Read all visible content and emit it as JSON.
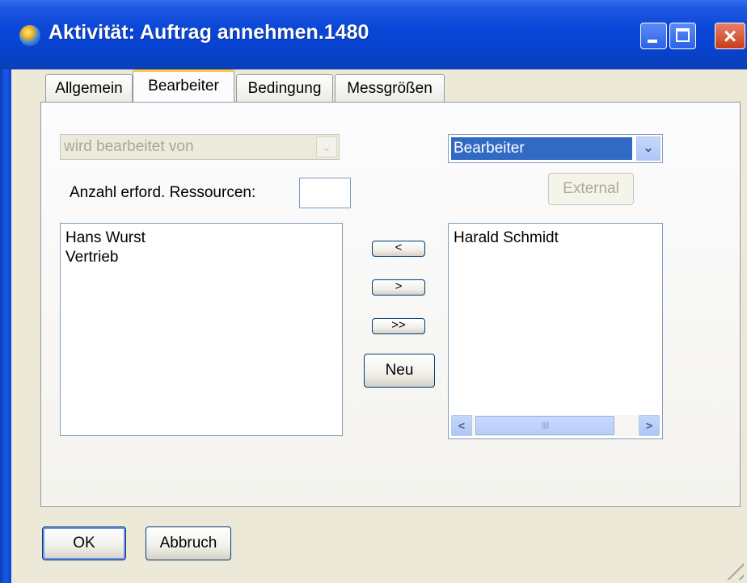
{
  "window": {
    "title": "Aktivität: Auftrag annehmen.1480",
    "icon": "app-globe-icon",
    "controls": {
      "minimize": "minimize-icon",
      "maximize": "maximize-icon",
      "close": "×"
    }
  },
  "tabs": [
    {
      "label": "Allgemein",
      "active": false
    },
    {
      "label": "Bearbeiter",
      "active": true
    },
    {
      "label": "Bedingung",
      "active": false
    },
    {
      "label": "Messgrößen",
      "active": false
    }
  ],
  "relation_combo": {
    "value": "wird bearbeitet von",
    "disabled": true,
    "arrow": "⌄"
  },
  "type_combo": {
    "value": "Bearbeiter",
    "arrow": "⌄"
  },
  "external_button": {
    "label": "External",
    "disabled": true
  },
  "resources": {
    "label": "Anzahl erford. Ressourcen:",
    "value": ""
  },
  "available_list": {
    "items": [
      "Hans Wurst",
      "Vertrieb"
    ]
  },
  "assigned_list": {
    "items": [
      "Harald Schmidt"
    ]
  },
  "move_buttons": {
    "left": "<",
    "right": ">",
    "all": ">>"
  },
  "new_button": {
    "label": "Neu"
  },
  "scrollbar": {
    "left_arrow": "<",
    "right_arrow": ">",
    "grip": "IIII"
  },
  "footer": {
    "ok_label": "OK",
    "cancel_label": "Abbruch"
  },
  "colors": {
    "title_bar": "#0843cf",
    "selection": "#316ac5",
    "active_tab_accent": "#ffc83c",
    "dialog_bg": "#ece9d8"
  }
}
